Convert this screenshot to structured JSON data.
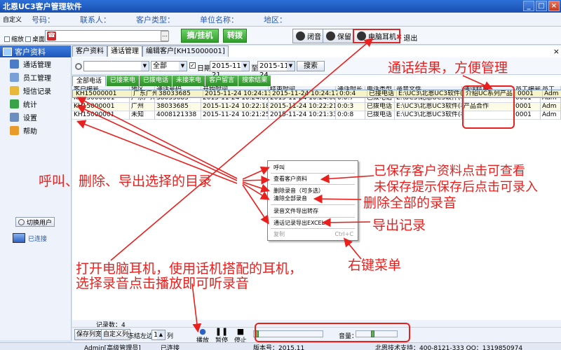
{
  "window": {
    "title": "北恩UC3客户管理软件",
    "controls": [
      "_",
      "□",
      "×"
    ]
  },
  "infobar": {
    "custom": "自定义",
    "fields": [
      "号码：",
      "联系人：",
      "客户类型：",
      "单位名称：",
      "地区："
    ]
  },
  "toolbar": {
    "chk_shrink": "缩放",
    "chk_desktop": "桌面",
    "phone_input": "",
    "dial_btn": "摘/挂机",
    "transfer_btn": "转拨",
    "mute_btn": "闭音",
    "hold_btn": "保留",
    "headset_btn": "电脑耳机",
    "exit_btn": "退出"
  },
  "sidebar": {
    "header": "客户资料",
    "items": [
      "通话管理",
      "员工管理",
      "短信记录",
      "统计",
      "设置",
      "帮助"
    ],
    "switch_user": "切换用户",
    "connection": "已连接"
  },
  "main": {
    "tabs": [
      "客户资料",
      "通话管理",
      "编辑客户[KH15000001]"
    ],
    "close": "×"
  },
  "filter": {
    "sel1": "",
    "sel2": "全部",
    "date_label": "日期",
    "date_from": "2015-11-21",
    "to": "至",
    "date_to": "2015-11-24",
    "search": "搜索"
  },
  "subtabs": [
    "全部电话",
    "已接来电",
    "已拨电话",
    "未接来电",
    "客户留言",
    "搜索结果"
  ],
  "grid": {
    "headers": [
      "客户编号",
      "地区",
      "通话号码",
      "开始时间",
      "结束时间",
      "通话时长",
      "电话类型",
      "录音文件",
      "通话结果",
      "员工编号",
      "员工"
    ],
    "rows": [
      [
        "KH15000001",
        "广东广州",
        "38033685",
        "2015-11-24 10:24:13",
        "2015-11-24 10:24:17",
        "0:0:4",
        "已接电话",
        "E:\\UC3\\北恩UC3软件(相",
        "介绍UC系列产品",
        "0001",
        "Adm"
      ],
      [
        "KH15000001",
        "广东广州",
        "38033685",
        "2015-11-24 10:24:01",
        "2015-11-24 10:24:08",
        "0:0:7",
        "已拨电话",
        "E:\\UC3\\北恩UC3软件(相",
        "",
        "0001",
        "Adm"
      ],
      [
        "KH15000001",
        "广州",
        "38033685",
        "2015-11-24 10:22:18",
        "2015-11-24 10:22:21",
        "0:0:3",
        "已拨电话",
        "E:\\UC3\\北恩UC3软件(相",
        "产品合作",
        "0001",
        "Adm"
      ],
      [
        "KH15000001",
        "未知",
        "4008121338",
        "2015-11-24 10:21:25",
        "2015-11-24 10:21:33",
        "0:0:8",
        "已拨电话",
        "E:\\UC3\\北恩UC3软件(相",
        "",
        "0001",
        "Adm"
      ]
    ],
    "record_count": "记录数：4"
  },
  "player": {
    "save_columns": "保存列宽",
    "custom_columns": "自定义列",
    "freeze_left": "冻结左边",
    "freeze_value": "1",
    "freeze_unit": "列",
    "play": "播放",
    "pause": "暂停",
    "stop": "停止",
    "volume": "音量：",
    "progress": 0.02,
    "volume_level": 0.4
  },
  "statusbar": {
    "user": "Admin[高级管理员]",
    "status": "已连接",
    "version": "版本号：2015.11",
    "support": "北恩技术支持：400-8121-333 QQ：1319850974"
  },
  "context_menu": {
    "items": [
      "呼叫",
      "查看客户资料",
      "删除录音（可多选）",
      "清除全部录音",
      "录音文件导出转存",
      "通话记录导出EXCEL",
      "复制"
    ],
    "copy_shortcut": "Ctrl+C"
  },
  "annotations": {
    "result": "通话结果，方便管理",
    "call_delete": "呼叫、删除、导出选择的目录",
    "saved_line1": "已保存客户资料点击可查看",
    "saved_line2": "未保存提示保存后点击可录入",
    "clear_all": "删除全部的录音",
    "export": "导出记录",
    "right_menu": "右键菜单",
    "headset_line1": "打开电脑耳机，使用话机搭配的耳机，",
    "headset_line2": "选择录音点击播放即可听录音"
  },
  "colors": {
    "annotation": "#e8201e",
    "title_bar": "#1a4fb0",
    "green_button": "#2f9e2a"
  }
}
